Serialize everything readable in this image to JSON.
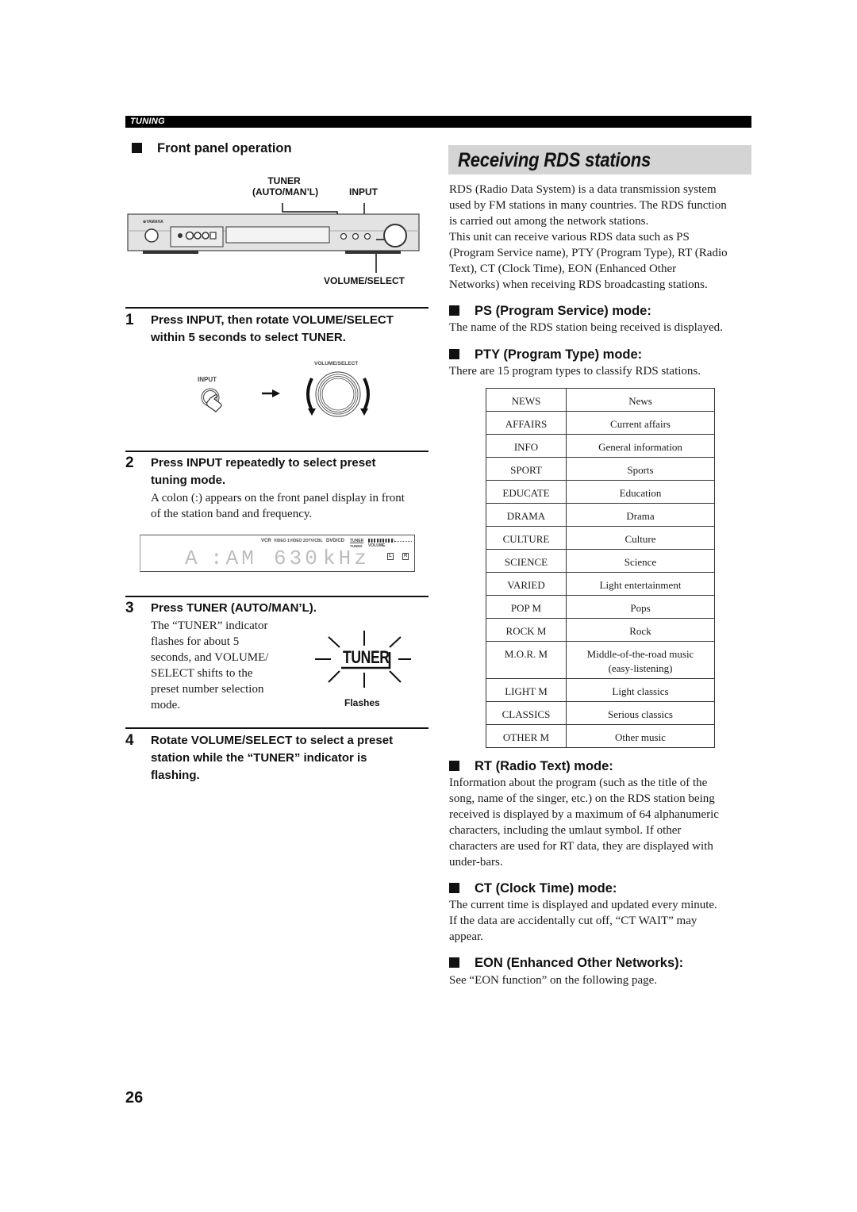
{
  "header": {
    "section_label": "TUNING"
  },
  "left": {
    "front_panel": {
      "heading": "Front panel operation",
      "callouts": {
        "tuner_line1": "TUNER",
        "tuner_line2": "(AUTO/MAN’L)",
        "input": "INPUT",
        "volume_select": "VOLUME/SELECT"
      },
      "device_brand": "YAMAHA"
    },
    "steps": [
      {
        "number": "1",
        "title_line1": "Press INPUT, then rotate VOLUME/SELECT",
        "title_line2": "within 5 seconds to select TUNER.",
        "illustration": {
          "input_label": "INPUT",
          "knob_label": "VOLUME/SELECT"
        }
      },
      {
        "number": "2",
        "title_line1": "Press INPUT repeatedly to select preset",
        "title_line2": "tuning mode.",
        "body_line1": "A colon (:) appears on the front panel display in front",
        "body_line2": "of the station band and frequency.",
        "display": {
          "inputs": [
            "VCR",
            "VIDEO 1",
            "VIDEO 2",
            "DTV/CBL",
            "DVD/CD",
            "TUNER"
          ],
          "sub_label": "TUNED",
          "volume_label": "VOLUME",
          "readout_preset": "A",
          "readout_band": ":AM",
          "readout_freq": "630",
          "readout_unit": "kHz",
          "left_indicator": "L",
          "right_indicator": "R"
        }
      },
      {
        "number": "3",
        "title": "Press TUNER (AUTO/MAN’L).",
        "body_lines": [
          "The “TUNER” indicator",
          "flashes for about 5",
          "seconds, and VOLUME/",
          "SELECT shifts to the",
          "preset number selection",
          "mode."
        ],
        "indicator_text": "TUNER",
        "indicator_caption": "Flashes"
      },
      {
        "number": "4",
        "title_line1": "Rotate VOLUME/SELECT to select a preset",
        "title_line2": "station while the “TUNER” indicator is",
        "title_line3": "flashing."
      }
    ]
  },
  "right": {
    "title": "Receiving RDS stations",
    "intro_lines": [
      "RDS (Radio Data System) is a data transmission system",
      "used by FM stations in many countries. The RDS function",
      "is carried out among the network stations.",
      "This unit can receive various RDS data such as PS",
      "(Program Service name), PTY (Program Type), RT (Radio",
      "Text), CT (Clock Time), EON (Enhanced Other",
      "Networks) when receiving RDS broadcasting stations."
    ],
    "ps": {
      "heading": "PS (Program Service) mode:",
      "body": "The name of the RDS station being received is displayed."
    },
    "pty": {
      "heading": "PTY (Program Type) mode:",
      "body": "There are 15 program types to classify RDS stations.",
      "table": [
        {
          "code": "NEWS",
          "desc": "News"
        },
        {
          "code": "AFFAIRS",
          "desc": "Current affairs"
        },
        {
          "code": "INFO",
          "desc": "General information"
        },
        {
          "code": "SPORT",
          "desc": "Sports"
        },
        {
          "code": "EDUCATE",
          "desc": "Education"
        },
        {
          "code": "DRAMA",
          "desc": "Drama"
        },
        {
          "code": "CULTURE",
          "desc": "Culture"
        },
        {
          "code": "SCIENCE",
          "desc": "Science"
        },
        {
          "code": "VARIED",
          "desc": "Light entertainment"
        },
        {
          "code": "POP M",
          "desc": "Pops"
        },
        {
          "code": "ROCK M",
          "desc": "Rock"
        },
        {
          "code": "M.O.R. M",
          "desc": "Middle-of-the-road music",
          "desc2": "(easy-listening)"
        },
        {
          "code": "LIGHT M",
          "desc": "Light classics"
        },
        {
          "code": "CLASSICS",
          "desc": "Serious classics"
        },
        {
          "code": "OTHER M",
          "desc": "Other music"
        }
      ]
    },
    "rt": {
      "heading": "RT (Radio Text) mode:",
      "body_lines": [
        "Information about the program (such as the title of the",
        "song, name of the singer, etc.) on the RDS station being",
        "received is displayed by a maximum of 64 alphanumeric",
        "characters, including the umlaut symbol. If other",
        "characters are used for RT data, they are displayed with",
        "under-bars."
      ]
    },
    "ct": {
      "heading": "CT (Clock Time) mode:",
      "body_lines": [
        "The current time is displayed and updated every minute.",
        "If the data are accidentally cut off, “CT WAIT” may",
        "appear."
      ]
    },
    "eon": {
      "heading": "EON (Enhanced Other Networks):",
      "body": "See “EON function” on the following page."
    }
  },
  "footer": {
    "page_number": "26"
  }
}
